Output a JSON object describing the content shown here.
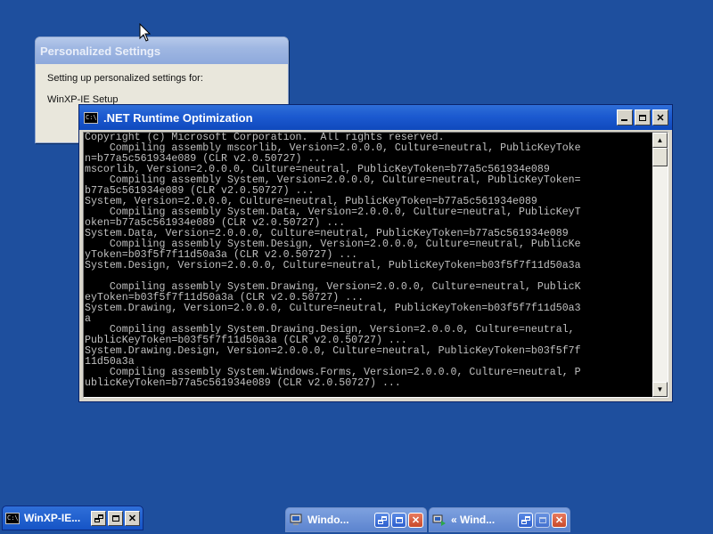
{
  "personalized_settings": {
    "title": "Personalized Settings",
    "message": "Setting up personalized settings for:",
    "item": "WinXP-IE Setup"
  },
  "console": {
    "title": ".NET Runtime Optimization",
    "icon_text": "C:\\",
    "lines": [
      "Copyright (c) Microsoft Corporation.  All rights reserved.",
      "    Compiling assembly mscorlib, Version=2.0.0.0, Culture=neutral, PublicKeyToke",
      "n=b77a5c561934e089 (CLR v2.0.50727) ...",
      "mscorlib, Version=2.0.0.0, Culture=neutral, PublicKeyToken=b77a5c561934e089",
      "    Compiling assembly System, Version=2.0.0.0, Culture=neutral, PublicKeyToken=",
      "b77a5c561934e089 (CLR v2.0.50727) ...",
      "System, Version=2.0.0.0, Culture=neutral, PublicKeyToken=b77a5c561934e089",
      "    Compiling assembly System.Data, Version=2.0.0.0, Culture=neutral, PublicKeyT",
      "oken=b77a5c561934e089 (CLR v2.0.50727) ...",
      "System.Data, Version=2.0.0.0, Culture=neutral, PublicKeyToken=b77a5c561934e089",
      "    Compiling assembly System.Design, Version=2.0.0.0, Culture=neutral, PublicKe",
      "yToken=b03f5f7f11d50a3a (CLR v2.0.50727) ...",
      "System.Design, Version=2.0.0.0, Culture=neutral, PublicKeyToken=b03f5f7f11d50a3a",
      "",
      "    Compiling assembly System.Drawing, Version=2.0.0.0, Culture=neutral, PublicK",
      "eyToken=b03f5f7f11d50a3a (CLR v2.0.50727) ...",
      "System.Drawing, Version=2.0.0.0, Culture=neutral, PublicKeyToken=b03f5f7f11d50a3",
      "a",
      "    Compiling assembly System.Drawing.Design, Version=2.0.0.0, Culture=neutral,",
      "PublicKeyToken=b03f5f7f11d50a3a (CLR v2.0.50727) ...",
      "System.Drawing.Design, Version=2.0.0.0, Culture=neutral, PublicKeyToken=b03f5f7f",
      "11d50a3a",
      "    Compiling assembly System.Windows.Forms, Version=2.0.0.0, Culture=neutral, P",
      "ublicKeyToken=b77a5c561934e089 (CLR v2.0.50727) ..."
    ]
  },
  "minimized": [
    {
      "label": "WinXP-IE..."
    },
    {
      "label": "Windo..."
    },
    {
      "label": "« Wind..."
    }
  ],
  "colors": {
    "desktop": "#1e4f9e",
    "active_title": "#1c5ad0",
    "console_text": "#c0c0c0"
  }
}
